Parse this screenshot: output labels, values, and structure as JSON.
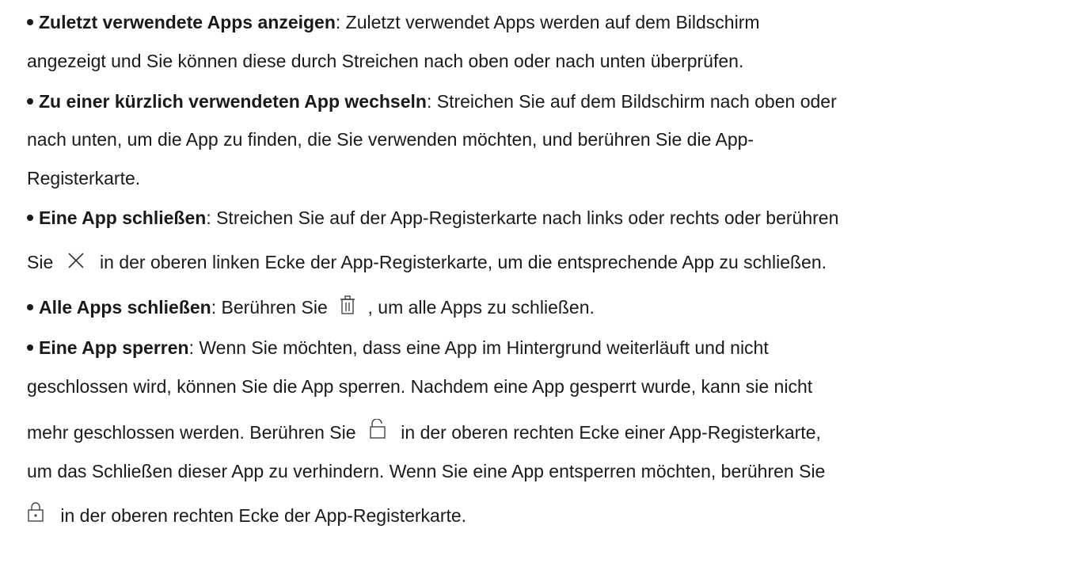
{
  "items": [
    {
      "bold": "Zuletzt verwendete Apps anzeigen",
      "lines": [
        ": Zuletzt verwendet Apps werden auf dem Bildschirm",
        "angezeigt und Sie können diese durch Streichen nach oben oder nach unten überprüfen."
      ]
    },
    {
      "bold": "Zu einer kürzlich verwendeten App wechseln",
      "lines": [
        ": Streichen Sie auf dem Bildschirm nach oben oder",
        "nach unten, um die App zu finden, die Sie verwenden möchten, und berühren Sie die App-",
        "Registerkarte."
      ]
    },
    {
      "bold": "Eine App schließen",
      "lines": [
        ": Streichen Sie auf der App-Registerkarte nach links oder rechts oder berühren"
      ],
      "icon_line": {
        "before": "Sie",
        "after": "in der oberen linken Ecke der App-Registerkarte, um die entsprechende App zu schließen."
      }
    },
    {
      "bold": "Alle Apps schließen",
      "before_icon": ": Berühren Sie",
      "after_icon": ", um alle Apps zu schließen."
    },
    {
      "bold": "Eine App sperren",
      "lines": [
        ": Wenn Sie möchten, dass eine App im Hintergrund weiterläuft und nicht",
        "geschlossen wird, können Sie die App sperren. Nachdem eine App gesperrt wurde, kann sie nicht"
      ],
      "icon_line_1": {
        "before": "mehr geschlossen werden. Berühren Sie",
        "after": "in der oberen rechten Ecke einer App-Registerkarte,"
      },
      "line_4": "um das Schließen dieser App zu verhindern. Wenn Sie eine App entsperren möchten, berühren Sie",
      "icon_line_2": {
        "after": "in der oberen rechten Ecke der App-Registerkarte."
      }
    }
  ],
  "icons": {
    "close": "close-icon",
    "trash": "trash-icon",
    "unlock": "unlock-icon",
    "lock": "lock-icon"
  }
}
